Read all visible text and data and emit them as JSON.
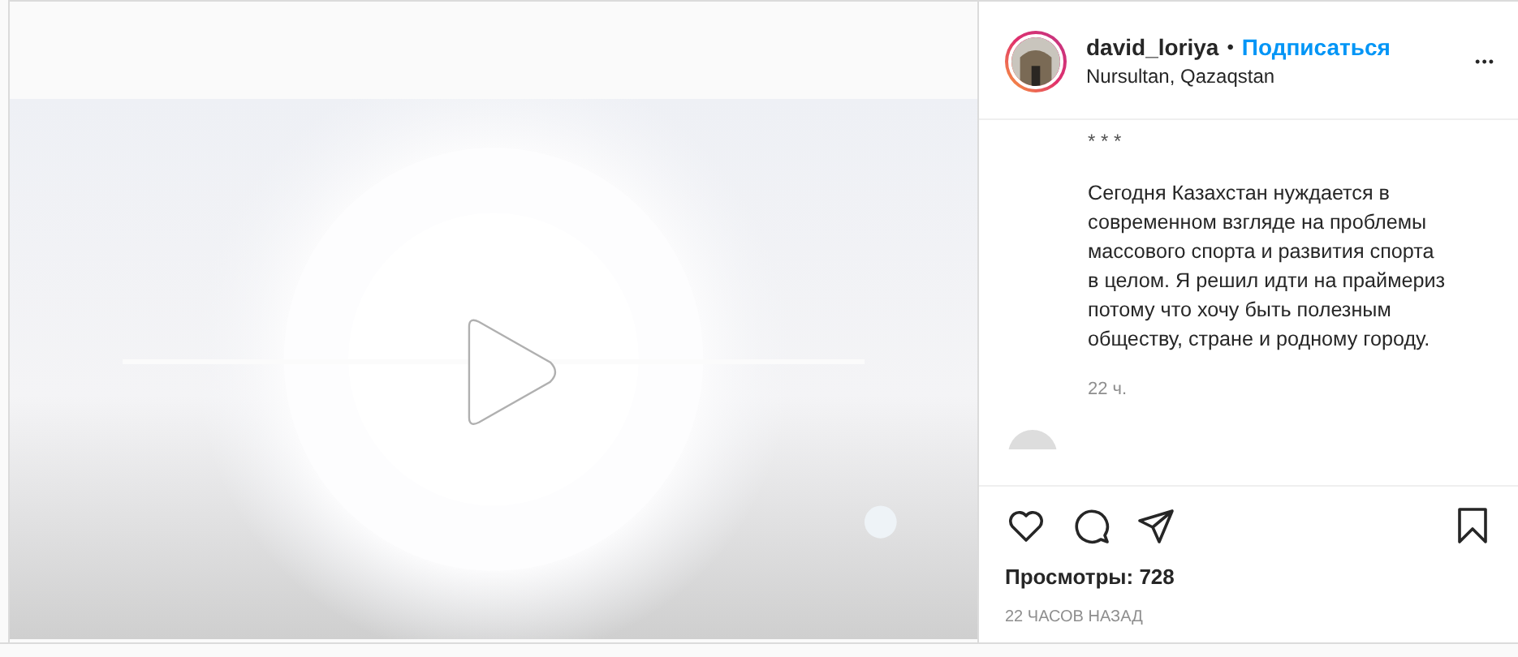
{
  "post": {
    "media": {
      "kind": "video"
    },
    "author": {
      "username": "david_loriya",
      "separator": "•",
      "follow": "Подписаться",
      "location": "Nursultan, Qazaqstan",
      "more": "•••"
    },
    "caption": {
      "lines": [
        "* * *",
        "Сегодня Казахстан нуждается в современном взгляде на проблемы массового спорта и развития спорта в целом. Я решил идти на праймериз потому что хочу быть полезным обществу, стране и родному городу."
      ],
      "time": "22 ч."
    },
    "actions": {
      "liked": false,
      "saved": false
    },
    "views": "Просмотры: 728",
    "posted": "22 ЧАСОВ НАЗАД"
  }
}
